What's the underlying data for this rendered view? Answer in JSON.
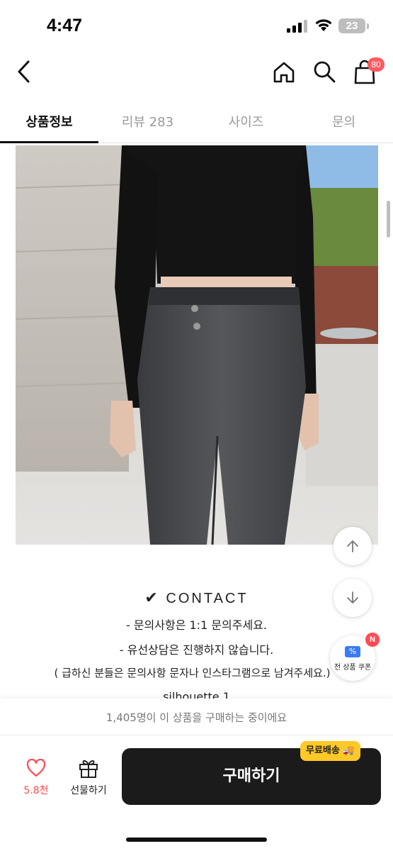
{
  "status_bar": {
    "time": "4:47",
    "battery": "23"
  },
  "header": {
    "cart_count": "80"
  },
  "tabs": [
    {
      "label": "상품정보",
      "active": true
    },
    {
      "label": "리뷰 283",
      "active": false
    },
    {
      "label": "사이즈",
      "active": false
    },
    {
      "label": "문의",
      "active": false
    }
  ],
  "description": {
    "contact_check": "✔",
    "contact_title": "CONTACT",
    "lines": [
      "- 문의사항은   1:1 문의주세요.",
      "- 유선상담은 진행하지 않습니다.",
      "( 급하신 분들은 문의사항 문자나 인스타그램으로 남겨주세요.)",
      "silhouette     1"
    ]
  },
  "coupon": {
    "label": "전 상품 쿠폰",
    "badge": "N",
    "ticket": "%"
  },
  "bottom": {
    "buying_notice": "1,405명이 이 상품을 구매하는 중이에요",
    "like_count": "5.8천",
    "gift_label": "선물하기",
    "buy_label": "구매하기",
    "free_shipping_label": "무료배송 🚚"
  },
  "icons": {
    "back": "back-icon",
    "home": "home-icon",
    "search": "search-icon",
    "cart": "cart-icon",
    "scroll_up": "arrow-up-icon",
    "scroll_down": "arrow-down-icon",
    "heart": "heart-icon",
    "gift": "gift-icon"
  },
  "colors": {
    "accent_red": "#ff4b55",
    "buy_button": "#1b1b1b",
    "free_ship": "#ffc928",
    "coupon_blue": "#3a7bf5"
  }
}
